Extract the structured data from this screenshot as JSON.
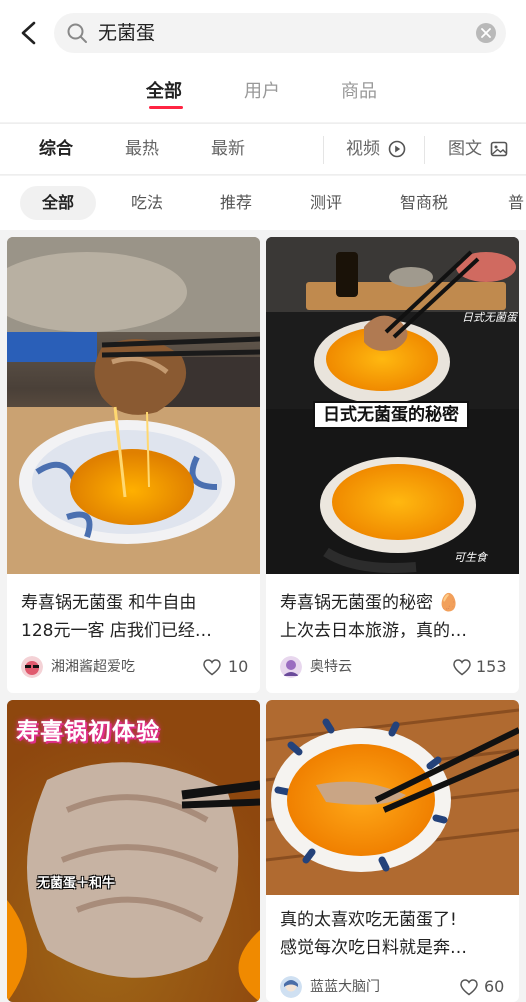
{
  "search": {
    "query": "无菌蛋"
  },
  "tabs": [
    {
      "label": "全部",
      "active": true
    },
    {
      "label": "用户",
      "active": false
    },
    {
      "label": "商品",
      "active": false
    }
  ],
  "filters": {
    "sort": [
      {
        "label": "综合",
        "active": true
      },
      {
        "label": "最热",
        "active": false
      },
      {
        "label": "最新",
        "active": false
      }
    ],
    "video_label": "视频",
    "image_text_label": "图文"
  },
  "chips": [
    {
      "label": "全部",
      "active": true
    },
    {
      "label": "吃法",
      "active": false
    },
    {
      "label": "推荐",
      "active": false
    },
    {
      "label": "测评",
      "active": false
    },
    {
      "label": "智商税",
      "active": false
    },
    {
      "label": "普",
      "active": false
    }
  ],
  "colors": {
    "accent": "#ff2442",
    "background": "#f3f3f3"
  },
  "feed": [
    {
      "title_line1": "寿喜锅无菌蛋 和牛自由",
      "title_line2": "128元一客 店我们已经…",
      "author": "湘湘酱超爱吃",
      "likes": "10",
      "image_texts": []
    },
    {
      "title_line1": "寿喜锅无菌蛋的秘密 🥚",
      "title_line2": "上次去日本旅游，真的…",
      "author": "奥特云",
      "likes": "153",
      "image_texts": [
        "日式无菌蛋的秘密",
        "日式无菌蛋",
        "可生食"
      ]
    },
    {
      "title_line1": "",
      "title_line2": "",
      "author": "",
      "likes": "",
      "image_texts": [
        "寿喜锅初体验",
        "无菌蛋＋和牛"
      ]
    },
    {
      "title_line1": "真的太喜欢吃无菌蛋了!",
      "title_line2": "感觉每次吃日料就是奔…",
      "author": "蓝蓝大脑门",
      "likes": "60",
      "image_texts": []
    }
  ]
}
